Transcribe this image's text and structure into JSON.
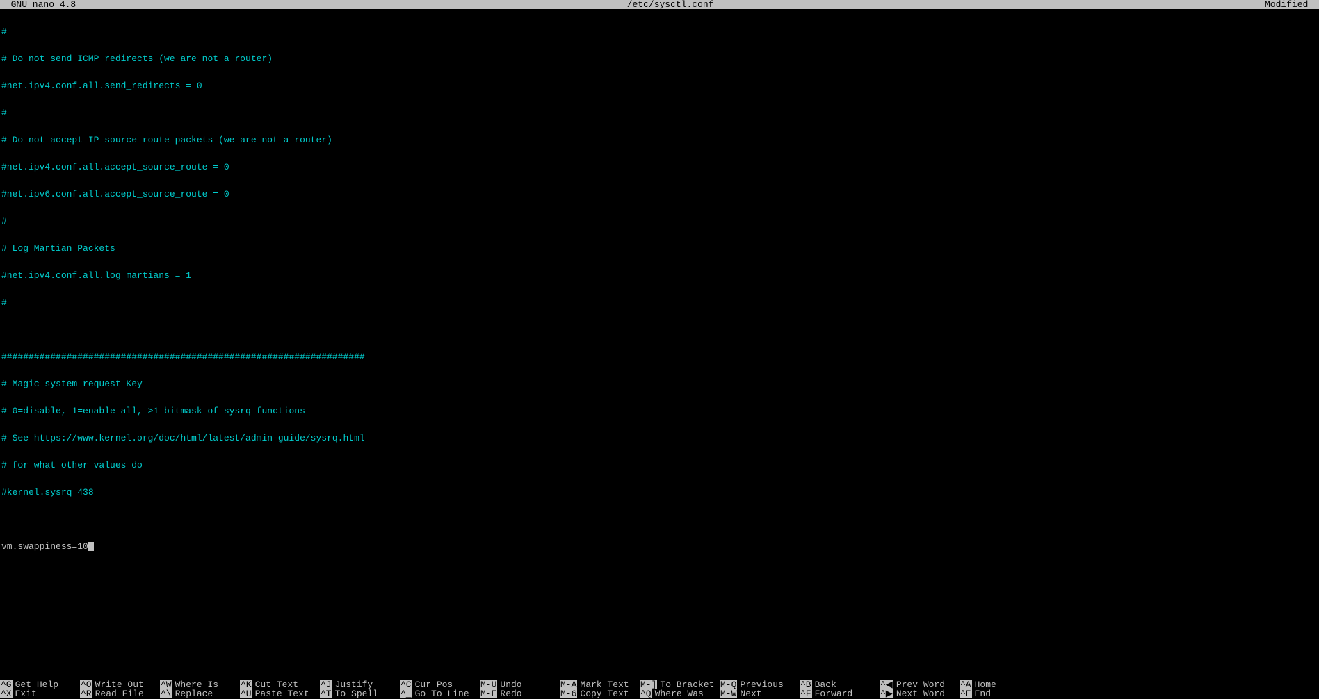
{
  "title_bar": {
    "left": "  GNU nano 4.8",
    "center": "/etc/sysctl.conf",
    "right": "Modified  "
  },
  "content": {
    "lines": [
      "#",
      "# Do not send ICMP redirects (we are not a router)",
      "#net.ipv4.conf.all.send_redirects = 0",
      "#",
      "# Do not accept IP source route packets (we are not a router)",
      "#net.ipv4.conf.all.accept_source_route = 0",
      "#net.ipv6.conf.all.accept_source_route = 0",
      "#",
      "# Log Martian Packets",
      "#net.ipv4.conf.all.log_martians = 1",
      "#",
      "",
      "###################################################################",
      "# Magic system request Key",
      "# 0=disable, 1=enable all, >1 bitmask of sysrq functions",
      "# See https://www.kernel.org/doc/html/latest/admin-guide/sysrq.html",
      "# for what other values do",
      "#kernel.sysrq=438",
      ""
    ],
    "active_line": "vm.swappiness=10"
  },
  "help": {
    "row1": [
      {
        "key": "^G",
        "label": "Get Help"
      },
      {
        "key": "^O",
        "label": "Write Out"
      },
      {
        "key": "^W",
        "label": "Where Is"
      },
      {
        "key": "^K",
        "label": "Cut Text"
      },
      {
        "key": "^J",
        "label": "Justify"
      },
      {
        "key": "^C",
        "label": "Cur Pos"
      },
      {
        "key": "M-U",
        "label": "Undo"
      },
      {
        "key": "M-A",
        "label": "Mark Text"
      },
      {
        "key": "M-]",
        "label": "To Bracket"
      },
      {
        "key": "M-Q",
        "label": "Previous"
      },
      {
        "key": "^B",
        "label": "Back"
      },
      {
        "key": "^◀",
        "label": "Prev Word"
      },
      {
        "key": "^A",
        "label": "Home"
      }
    ],
    "row2": [
      {
        "key": "^X",
        "label": "Exit"
      },
      {
        "key": "^R",
        "label": "Read File"
      },
      {
        "key": "^\\",
        "label": "Replace"
      },
      {
        "key": "^U",
        "label": "Paste Text"
      },
      {
        "key": "^T",
        "label": "To Spell"
      },
      {
        "key": "^_",
        "label": "Go To Line"
      },
      {
        "key": "M-E",
        "label": "Redo"
      },
      {
        "key": "M-6",
        "label": "Copy Text"
      },
      {
        "key": "^Q",
        "label": "Where Was"
      },
      {
        "key": "M-W",
        "label": "Next"
      },
      {
        "key": "^F",
        "label": "Forward"
      },
      {
        "key": "^▶",
        "label": "Next Word"
      },
      {
        "key": "^E",
        "label": "End"
      }
    ]
  }
}
